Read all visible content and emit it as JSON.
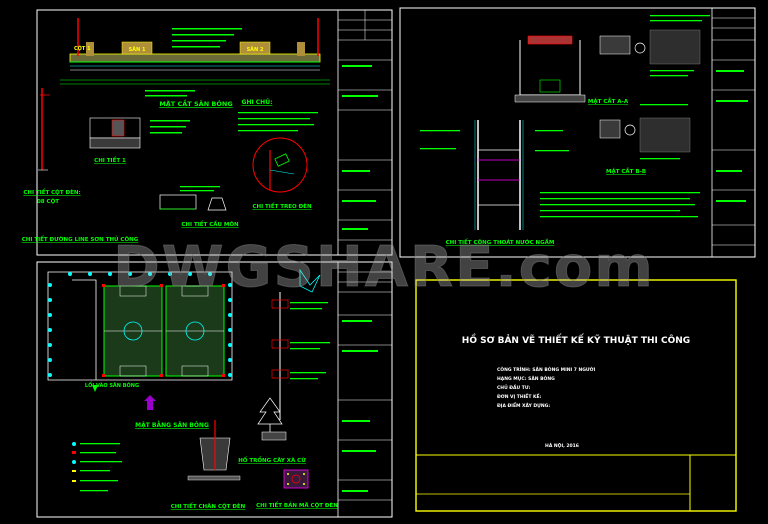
{
  "watermark": "DWGSHARE.com",
  "sheet1": {
    "section_labels": [
      "SÂN 1",
      "SÂN 2"
    ],
    "pole_label": "CỘT 1",
    "titles": {
      "section": "MẶT CẮT SÂN BÓNG",
      "notes": "GHI CHÚ:",
      "detail1": "CHI TIẾT 1",
      "pole": "CHI TIẾT CỘT ĐÈN:",
      "pole_count": "08 CỘT",
      "lamp": "CHI TIẾT TREO ĐÈN",
      "goal": "CHI TIẾT CẦU MÔN",
      "line": "CHI TIẾT ĐƯỜNG LINE SƠN THỦ CÔNG"
    }
  },
  "sheet2": {
    "titles": {
      "section_a": "MẶT CẮT A-A",
      "section_b": "MẶT CẮT B-B",
      "drain": "CHI TIẾT CÔNG THOÁT NƯỚC NGẦM"
    }
  },
  "sheet3": {
    "entrance": "LỐI VÀO SÂN BÓNG",
    "titles": {
      "plan": "MẶT BẰNG SÂN BÓNG",
      "tree": "HỐ TRỒNG CÂY XÀ CỪ",
      "pole_base": "CHI TIẾT CHÂN CỘT ĐÈN",
      "base_plate": "CHI TIẾT BẢN MÃ CỘT ĐÈN"
    }
  },
  "cover": {
    "title": "HỒ SƠ BẢN VẼ THIẾT KẾ KỸ THUẬT THI CÔNG",
    "lines": [
      "CÔNG TRÌNH: SÂN BÓNG MINI 7 NGƯỜI",
      "HẠNG MỤC: SÂN BÓNG",
      "CHỦ ĐẦU TƯ:",
      "ĐƠN VỊ THIẾT KẾ:",
      "ĐỊA ĐIỂM XÂY DỰNG:"
    ],
    "date": "HÀ NỘI, 2016"
  },
  "colors": {
    "background": "#000000",
    "frame": "#ffffff",
    "cad_green": "#00ff00",
    "cad_red": "#ff0000",
    "cad_yellow": "#ffff00",
    "cad_magenta": "#ff00ff",
    "cad_cyan": "#00ffff"
  }
}
